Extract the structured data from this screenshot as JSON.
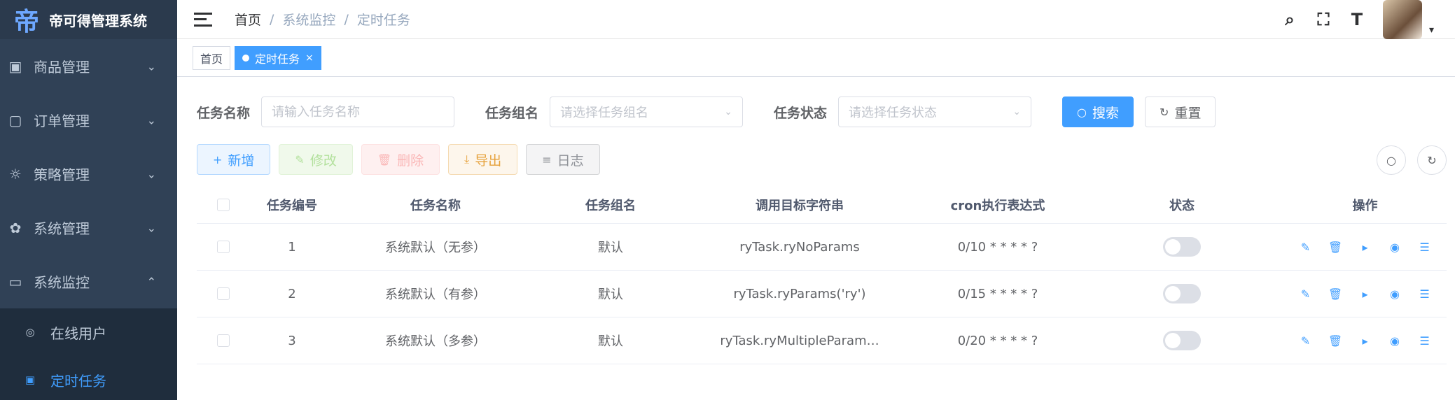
{
  "app": {
    "logo_glyph": "帝",
    "title": "帝可得管理系统"
  },
  "sidebar": {
    "items": [
      {
        "icon": "▣",
        "label": "商品管理",
        "arrow": "⌄"
      },
      {
        "icon": "▢",
        "label": "订单管理",
        "arrow": "⌄"
      },
      {
        "icon": "☼",
        "label": "策略管理",
        "arrow": "⌄"
      },
      {
        "icon": "✿",
        "label": "系统管理",
        "arrow": "⌄"
      },
      {
        "icon": "▭",
        "label": "系统监控",
        "arrow": "⌃"
      }
    ],
    "subitems": [
      {
        "icon": "◎",
        "label": "在线用户"
      },
      {
        "icon": "▣",
        "label": "定时任务"
      }
    ]
  },
  "breadcrumb": {
    "items": [
      "首页",
      "系统监控",
      "定时任务"
    ],
    "sep": "/"
  },
  "navbar": {
    "search_icon": "⌕",
    "fullscreen_icon": "⛶",
    "size_icon": "T",
    "caret": "▾"
  },
  "tags": {
    "home": "首页",
    "active": "定时任务",
    "close": "×"
  },
  "search": {
    "name_label": "任务名称",
    "name_placeholder": "请输入任务名称",
    "group_label": "任务组名",
    "group_placeholder": "请选择任务组名",
    "status_label": "任务状态",
    "status_placeholder": "请选择任务状态",
    "chevron": "⌄",
    "search_btn": "搜索",
    "reset_btn": "重置",
    "search_icon": "○",
    "reset_icon": "↻"
  },
  "toolbar": {
    "add": {
      "icon": "+",
      "label": "新增"
    },
    "edit": {
      "icon": "✎",
      "label": "修改"
    },
    "delete": {
      "icon": "🗑",
      "label": "删除"
    },
    "export": {
      "icon": "⤓",
      "label": "导出"
    },
    "log": {
      "icon": "≡",
      "label": "日志"
    },
    "search_toggle_icon": "○",
    "refresh_icon": "↻"
  },
  "table": {
    "columns": [
      "任务编号",
      "任务名称",
      "任务组名",
      "调用目标字符串",
      "cron执行表达式",
      "状态",
      "操作"
    ],
    "rows": [
      {
        "id": "1",
        "name": "系统默认（无参）",
        "group": "默认",
        "target": "ryTask.ryNoParams",
        "cron": "0/10 * * * * ?",
        "enabled": false
      },
      {
        "id": "2",
        "name": "系统默认（有参）",
        "group": "默认",
        "target": "ryTask.ryParams('ry')",
        "cron": "0/15 * * * * ?",
        "enabled": false
      },
      {
        "id": "3",
        "name": "系统默认（多参）",
        "group": "默认",
        "target": "ryTask.ryMultipleParam…",
        "cron": "0/20 * * * * ?",
        "enabled": false
      }
    ],
    "op_icons": {
      "edit": "✎",
      "delete": "🗑",
      "run": "▸",
      "view": "◉",
      "settings": "☰"
    }
  },
  "colors": {
    "sidebar_bg": "#304156",
    "primary": "#409eff",
    "active_menu": "#409eff"
  }
}
